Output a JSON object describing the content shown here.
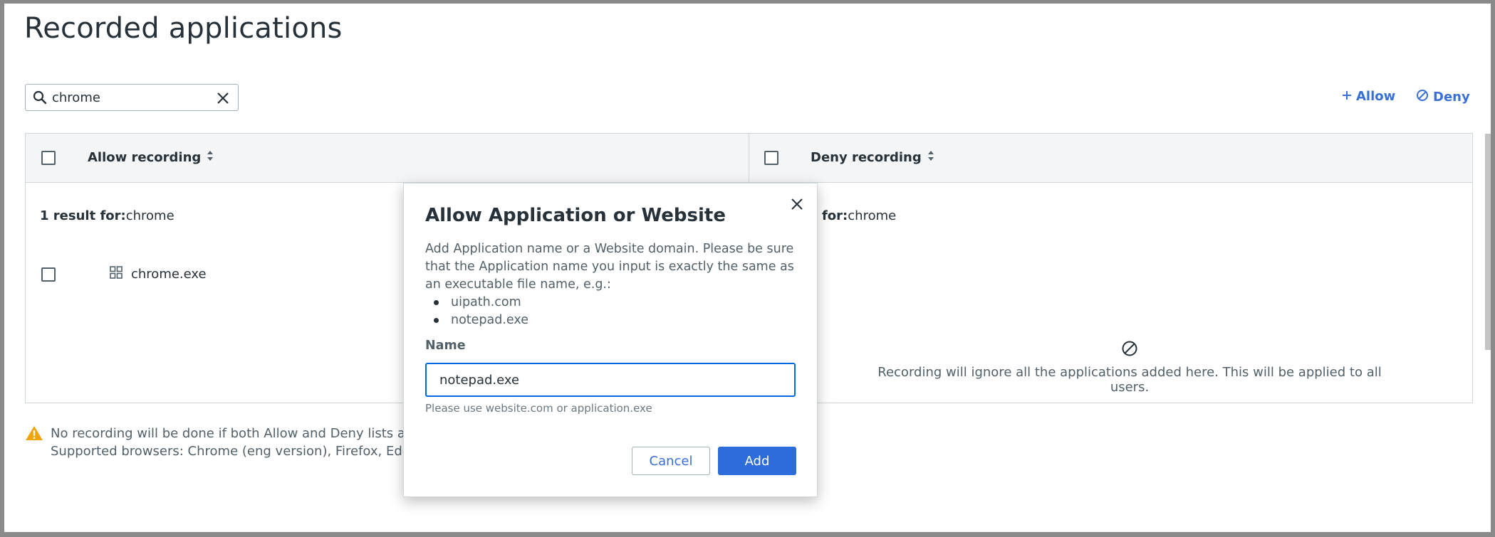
{
  "page": {
    "title": "Recorded applications"
  },
  "search": {
    "value": "chrome",
    "placeholder": ""
  },
  "toolbar": {
    "allow_label": "Allow",
    "deny_label": "Deny"
  },
  "table": {
    "allow_column": "Allow recording",
    "deny_column": "Deny recording",
    "allow_results_prefix": "1 result for:",
    "allow_results_term": "chrome",
    "deny_results_visible": "s for:",
    "deny_results_term": "chrome",
    "rows": [
      {
        "name": "chrome.exe",
        "icon": "grid-app-icon"
      }
    ],
    "deny_empty_text": "Recording will ignore all the applications added here. This will be applied to all users."
  },
  "warning": {
    "line1": "No recording will be done if both Allow and Deny lists are lef",
    "line2": "Supported browsers: Chrome (eng version), Firefox, Edge."
  },
  "modal": {
    "title": "Allow Application or Website",
    "description": "Add Application name or a Website domain. Please be sure that the Application name you input is exactly the same as an executable file name, e.g.:",
    "examples": [
      "uipath.com",
      "notepad.exe"
    ],
    "field_label": "Name",
    "field_value": "notepad.exe",
    "helper_text": "Please use website.com or application.exe",
    "cancel_label": "Cancel",
    "add_label": "Add"
  },
  "colors": {
    "accent": "#2f6cdb",
    "link": "#3a6fd8",
    "warning": "#f0a30a"
  }
}
